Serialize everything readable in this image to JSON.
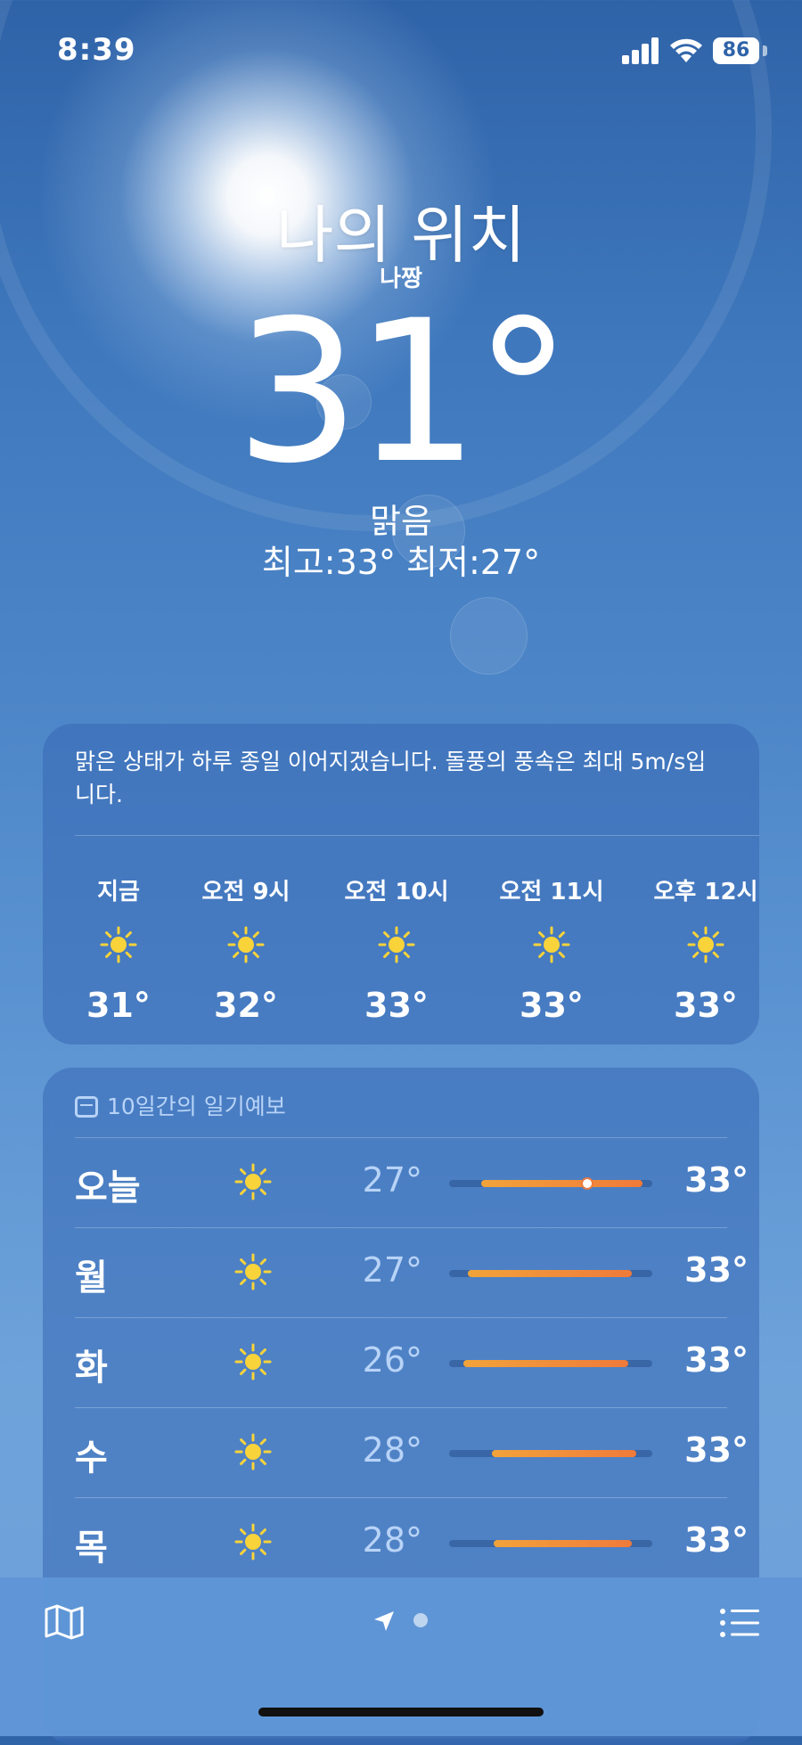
{
  "status": {
    "time": "8:39",
    "battery": "86"
  },
  "header": {
    "location": "나의 위치",
    "sublocation": "나짱",
    "temperature": "31°",
    "condition": "맑음",
    "high_low": "최고:33°  최저:27°"
  },
  "summary": "맑은 상태가 하루 종일 이어지겠습니다. 돌풍의 풍속은 최대 5m/s입니다.",
  "hourly": [
    {
      "label": "지금",
      "icon": "sun-icon",
      "temp": "31°"
    },
    {
      "label": "오전 9시",
      "icon": "sun-icon",
      "temp": "32°"
    },
    {
      "label": "오전 10시",
      "icon": "sun-icon",
      "temp": "33°"
    },
    {
      "label": "오전 11시",
      "icon": "sun-icon",
      "temp": "33°"
    },
    {
      "label": "오후 12시",
      "icon": "sun-icon",
      "temp": "33°"
    }
  ],
  "forecast": {
    "title": "10일간의 일기예보",
    "days": [
      {
        "day": "오늘",
        "icon": "sun-icon",
        "low": "27°",
        "high": "33°",
        "range": [
          0.16,
          0.95
        ],
        "current": 0.68
      },
      {
        "day": "월",
        "icon": "sun-icon",
        "low": "27°",
        "high": "33°",
        "range": [
          0.09,
          0.9
        ]
      },
      {
        "day": "화",
        "icon": "sun-icon",
        "low": "26°",
        "high": "33°",
        "range": [
          0.07,
          0.88
        ]
      },
      {
        "day": "수",
        "icon": "sun-icon",
        "low": "28°",
        "high": "33°",
        "range": [
          0.21,
          0.92
        ]
      },
      {
        "day": "목",
        "icon": "sun-icon",
        "low": "28°",
        "high": "33°",
        "range": [
          0.22,
          0.9
        ]
      }
    ]
  },
  "colors": {
    "accent_orange": "#f07a3a",
    "sun_yellow": "#f9d33a"
  }
}
